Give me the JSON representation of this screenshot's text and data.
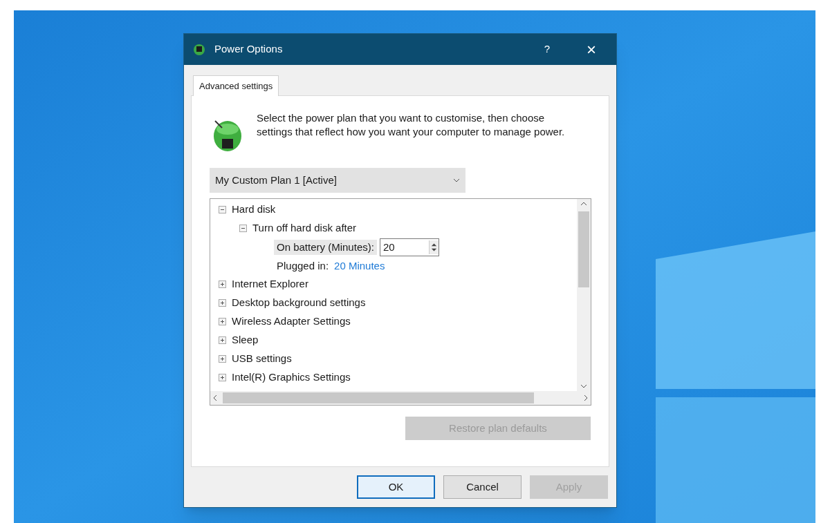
{
  "window": {
    "title": "Power Options",
    "help": "?",
    "close": "×"
  },
  "tabs": [
    {
      "label": "Advanced settings",
      "selected": true
    }
  ],
  "description": "Select the power plan that you want to customise, then choose settings that reflect how you want your computer to manage power.",
  "plan_select": {
    "value": "My Custom Plan 1 [Active]"
  },
  "tree": [
    {
      "label": "Hard disk",
      "expanded": true,
      "children": [
        {
          "label": "Turn off hard disk after",
          "expanded": true,
          "children": [
            {
              "kind": "spin",
              "label": "On battery (Minutes):",
              "value": "20"
            },
            {
              "kind": "link",
              "label": "Plugged in:",
              "value": "20 Minutes"
            }
          ]
        }
      ]
    },
    {
      "label": "Internet Explorer",
      "expanded": false
    },
    {
      "label": "Desktop background settings",
      "expanded": false
    },
    {
      "label": "Wireless Adapter Settings",
      "expanded": false
    },
    {
      "label": "Sleep",
      "expanded": false
    },
    {
      "label": "USB settings",
      "expanded": false
    },
    {
      "label": "Intel(R) Graphics Settings",
      "expanded": false
    }
  ],
  "restore_button": {
    "label": "Restore plan defaults",
    "disabled": true
  },
  "buttons": [
    {
      "label": "OK",
      "default": true,
      "disabled": false
    },
    {
      "label": "Cancel",
      "default": false,
      "disabled": false
    },
    {
      "label": "Apply",
      "default": false,
      "disabled": true
    }
  ]
}
